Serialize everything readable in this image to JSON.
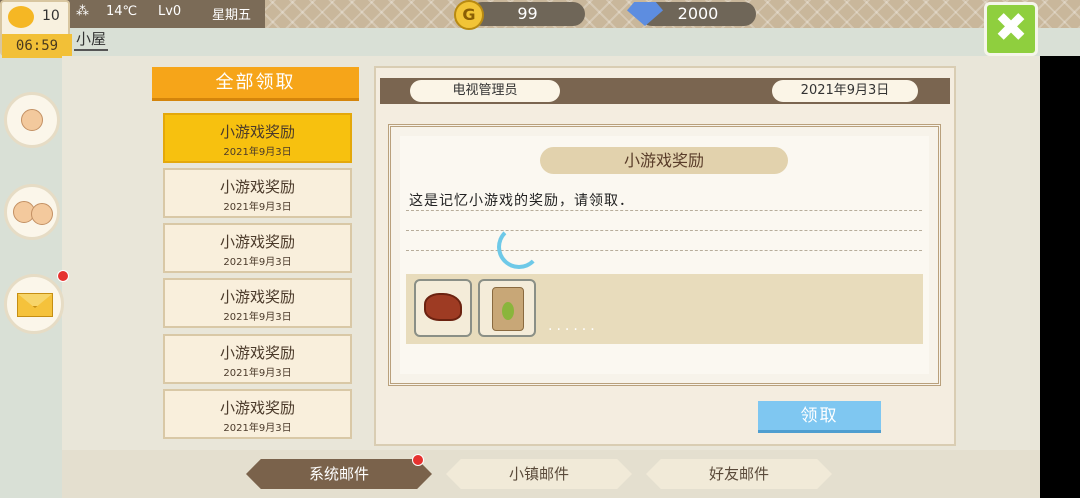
{
  "status": {
    "level_badge": "10",
    "clock": "06:59",
    "temperature": "14℃",
    "player_level": "Lv0",
    "weekday": "星期五",
    "home_tab": "小屋"
  },
  "currency": {
    "coin_symbol": "G",
    "coins": "99",
    "gems": "2000"
  },
  "close_icon": "✖",
  "claim_all_label": "全部领取",
  "mail_list": [
    {
      "title": "小游戏奖励",
      "date": "2021年9月3日"
    },
    {
      "title": "小游戏奖励",
      "date": "2021年9月3日"
    },
    {
      "title": "小游戏奖励",
      "date": "2021年9月3日"
    },
    {
      "title": "小游戏奖励",
      "date": "2021年9月3日"
    },
    {
      "title": "小游戏奖励",
      "date": "2021年9月3日"
    },
    {
      "title": "小游戏奖励",
      "date": "2021年9月3日"
    }
  ],
  "detail": {
    "sender": "电视管理员",
    "date": "2021年9月3日",
    "title": "小游戏奖励",
    "body": "这是记忆小游戏的奖励，请领取．",
    "dots": "......",
    "claim_label": "领取"
  },
  "tabs": {
    "system": "系统邮件",
    "town": "小镇邮件",
    "friends": "好友邮件"
  },
  "colors": {
    "accent_orange": "#f6a519",
    "selected_yellow": "#f7c10f",
    "claim_blue": "#7fc7f1",
    "close_green": "#8fcf3e"
  }
}
